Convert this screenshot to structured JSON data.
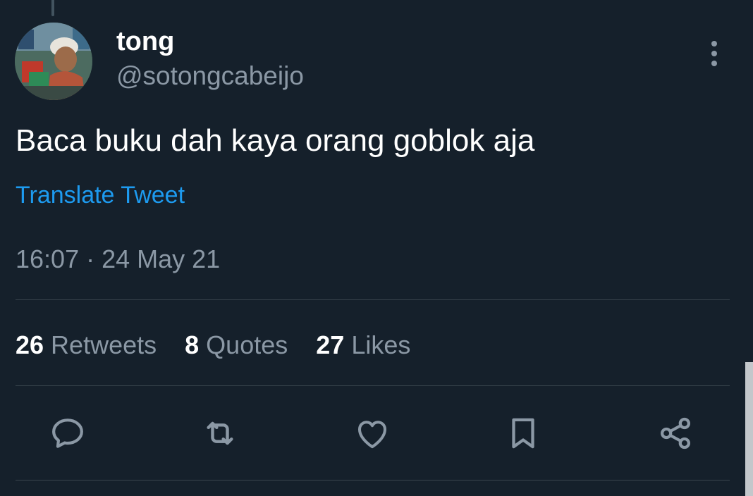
{
  "tweet": {
    "display_name": "tong",
    "handle": "@sotongcabeijo",
    "text": "Baca buku dah kaya orang goblok aja",
    "translate_label": "Translate Tweet",
    "timestamp": "16:07 · 24 May 21"
  },
  "stats": [
    {
      "count": "26",
      "label": "Retweets"
    },
    {
      "count": "8",
      "label": "Quotes"
    },
    {
      "count": "27",
      "label": "Likes"
    }
  ],
  "actions": [
    "reply-icon",
    "retweet-icon",
    "like-icon",
    "bookmark-icon",
    "share-icon"
  ],
  "colors": {
    "background": "#15202b",
    "primary_text": "#ffffff",
    "secondary_text": "#8b98a5",
    "link": "#1d9bf0",
    "divider": "#38444d"
  }
}
